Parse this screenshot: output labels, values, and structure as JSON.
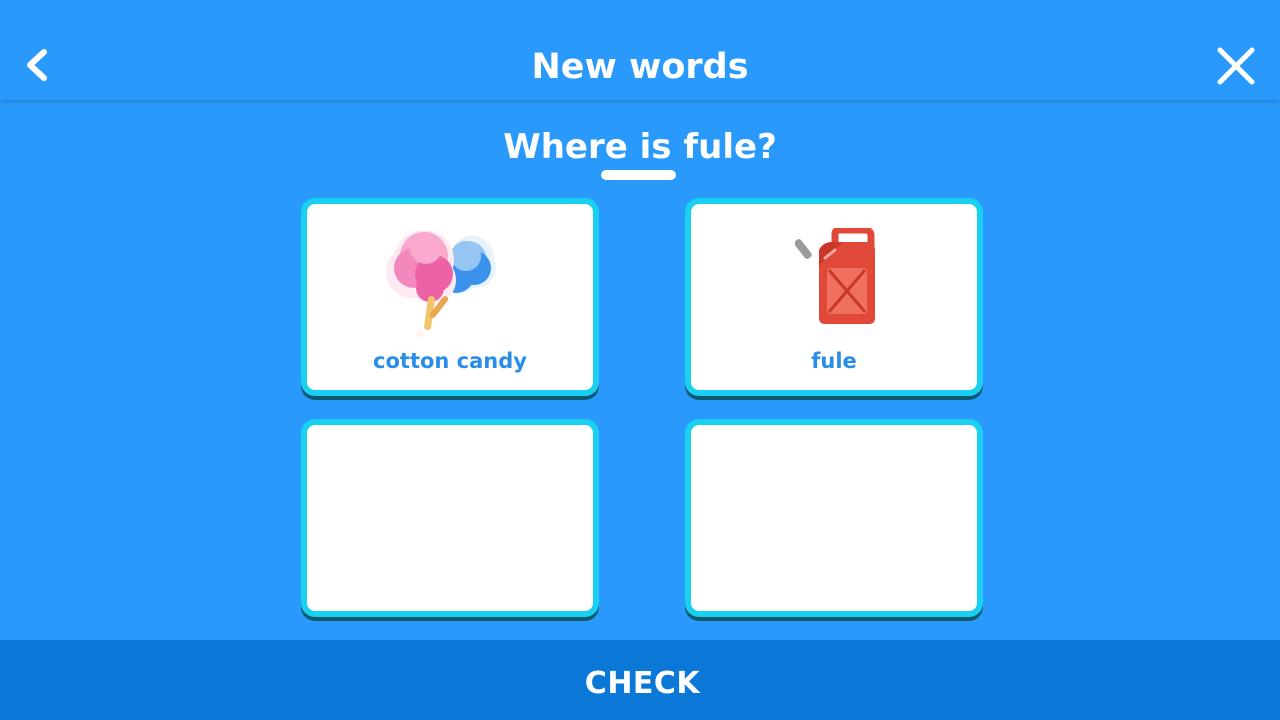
{
  "header": {
    "title": "New words",
    "back_icon": "chevron-left-icon",
    "close_icon": "close-icon"
  },
  "question": {
    "text": "Where is fule?"
  },
  "cards": [
    {
      "label": "cotton candy",
      "icon": "cotton-candy-icon"
    },
    {
      "label": "fule",
      "icon": "fuel-can-icon"
    },
    {
      "label": "",
      "icon": ""
    },
    {
      "label": "",
      "icon": ""
    }
  ],
  "footer": {
    "check_label": "CHECK"
  },
  "colors": {
    "background": "#2999fb",
    "card_border": "#1ad0f0",
    "label_text": "#2a8ee8",
    "footer": "#0b78d8"
  }
}
